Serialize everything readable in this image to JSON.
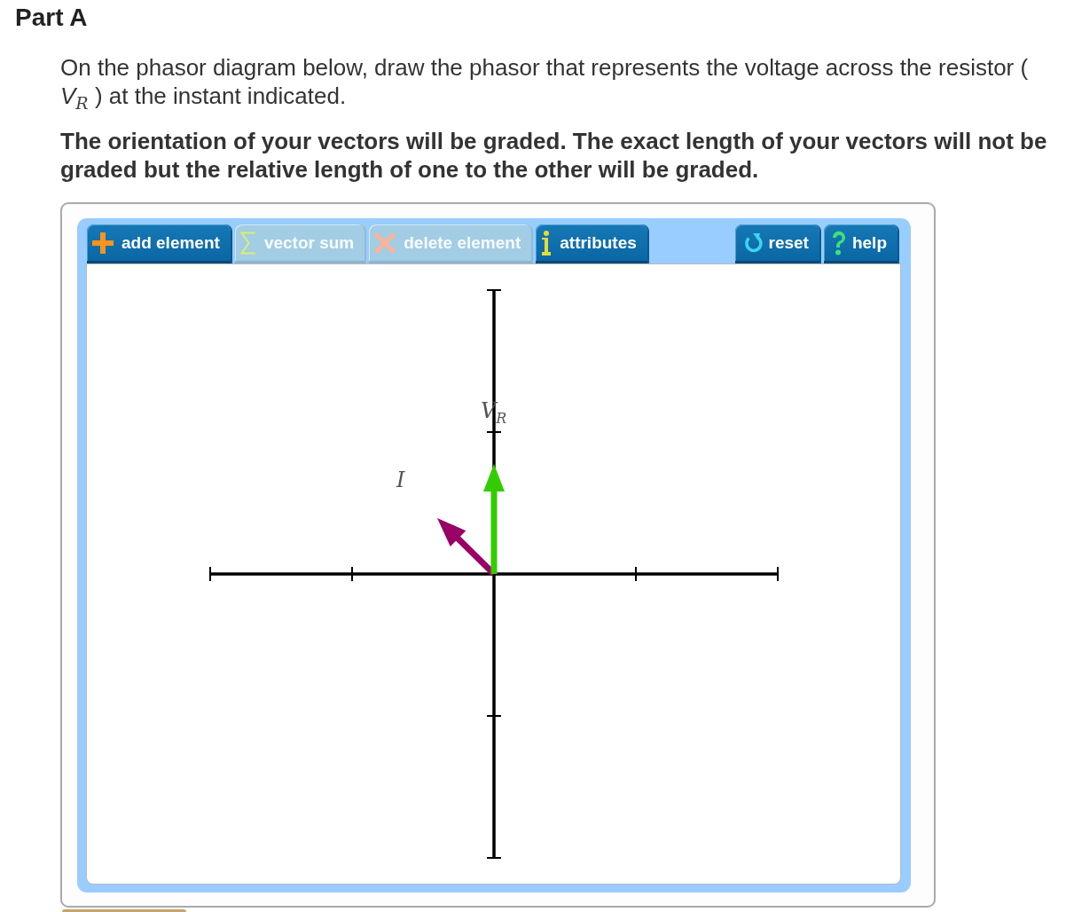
{
  "part": {
    "title": "Part A"
  },
  "instructions": {
    "prompt": "On the phasor diagram below, draw the phasor that represents the voltage across the resistor ( *V*$_{R}$ ) at the instant indicated.",
    "note": "The orientation of your vectors will be graded. The exact length of your vectors will not be graded but the relative length of one to the other will be graded."
  },
  "tool": {
    "tools": [
      {
        "label": "add element",
        "disabled": false
      },
      {
        "label": "vector sum",
        "disabled": true
      },
      {
        "label": "delete element",
        "disabled": true
      },
      {
        "label": "attributes",
        "disabled": false
      }
    ],
    "actions": [
      {
        "label": "reset"
      },
      {
        "label": "help"
      }
    ],
    "canvas": {
      "vectors": [
        {
          "label": "I",
          "color": "#990066"
        },
        {
          "label": "V$_{R}$",
          "color": "#33cc00"
        }
      ]
    }
  }
}
